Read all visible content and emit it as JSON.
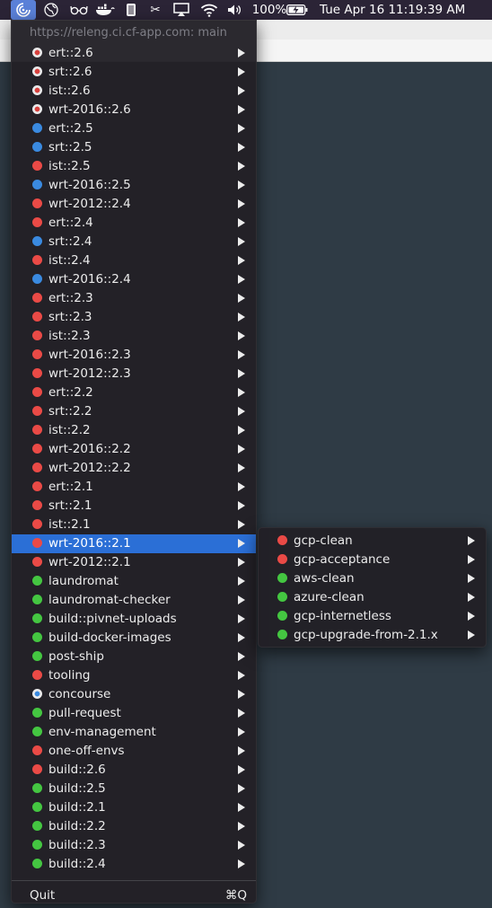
{
  "menubar": {
    "battery": "100%",
    "clock": "Tue Apr 16  11:19:39 AM"
  },
  "menu": {
    "header": "https://releng.ci.cf-app.com: main",
    "items": [
      {
        "label": "ert::2.6",
        "status": "pending-red"
      },
      {
        "label": "srt::2.6",
        "status": "pending-red"
      },
      {
        "label": "ist::2.6",
        "status": "pending-red"
      },
      {
        "label": "wrt-2016::2.6",
        "status": "pending-red"
      },
      {
        "label": "ert::2.5",
        "status": "blue"
      },
      {
        "label": "srt::2.5",
        "status": "blue"
      },
      {
        "label": "ist::2.5",
        "status": "red"
      },
      {
        "label": "wrt-2016::2.5",
        "status": "blue"
      },
      {
        "label": "wrt-2012::2.4",
        "status": "red"
      },
      {
        "label": "ert::2.4",
        "status": "red"
      },
      {
        "label": "srt::2.4",
        "status": "blue"
      },
      {
        "label": "ist::2.4",
        "status": "red"
      },
      {
        "label": "wrt-2016::2.4",
        "status": "blue"
      },
      {
        "label": "ert::2.3",
        "status": "red"
      },
      {
        "label": "srt::2.3",
        "status": "red"
      },
      {
        "label": "ist::2.3",
        "status": "red"
      },
      {
        "label": "wrt-2016::2.3",
        "status": "red"
      },
      {
        "label": "wrt-2012::2.3",
        "status": "red"
      },
      {
        "label": "ert::2.2",
        "status": "red"
      },
      {
        "label": "srt::2.2",
        "status": "red"
      },
      {
        "label": "ist::2.2",
        "status": "red"
      },
      {
        "label": "wrt-2016::2.2",
        "status": "red"
      },
      {
        "label": "wrt-2012::2.2",
        "status": "red"
      },
      {
        "label": "ert::2.1",
        "status": "red"
      },
      {
        "label": "srt::2.1",
        "status": "red"
      },
      {
        "label": "ist::2.1",
        "status": "red"
      },
      {
        "label": "wrt-2016::2.1",
        "status": "red",
        "highlighted": true
      },
      {
        "label": "wrt-2012::2.1",
        "status": "red"
      },
      {
        "label": "laundromat",
        "status": "green"
      },
      {
        "label": "laundromat-checker",
        "status": "green"
      },
      {
        "label": "build::pivnet-uploads",
        "status": "green"
      },
      {
        "label": "build-docker-images",
        "status": "green"
      },
      {
        "label": "post-ship",
        "status": "green"
      },
      {
        "label": "tooling",
        "status": "red"
      },
      {
        "label": "concourse",
        "status": "pending-blue"
      },
      {
        "label": "pull-request",
        "status": "green"
      },
      {
        "label": "env-management",
        "status": "green"
      },
      {
        "label": "one-off-envs",
        "status": "red"
      },
      {
        "label": "build::2.6",
        "status": "red"
      },
      {
        "label": "build::2.5",
        "status": "green"
      },
      {
        "label": "build::2.1",
        "status": "green"
      },
      {
        "label": "build::2.2",
        "status": "green"
      },
      {
        "label": "build::2.3",
        "status": "green"
      },
      {
        "label": "build::2.4",
        "status": "green"
      }
    ],
    "quit_label": "Quit",
    "quit_shortcut": "⌘Q"
  },
  "submenu": {
    "items": [
      {
        "label": "gcp-clean",
        "status": "red"
      },
      {
        "label": "gcp-acceptance",
        "status": "red"
      },
      {
        "label": "aws-clean",
        "status": "green"
      },
      {
        "label": "azure-clean",
        "status": "green"
      },
      {
        "label": "gcp-internetless",
        "status": "green"
      },
      {
        "label": "gcp-upgrade-from-2.1.x",
        "status": "green"
      }
    ]
  }
}
